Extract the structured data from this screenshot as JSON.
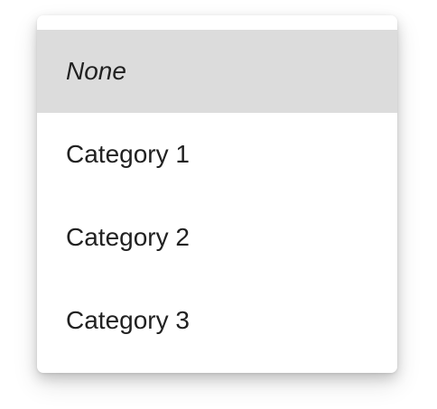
{
  "dropdown_menu": {
    "items": [
      {
        "label": "None",
        "selected": true,
        "italic": true
      },
      {
        "label": "Category 1",
        "selected": false,
        "italic": false
      },
      {
        "label": "Category 2",
        "selected": false,
        "italic": false
      },
      {
        "label": "Category 3",
        "selected": false,
        "italic": false
      }
    ],
    "colors": {
      "selected_background": "#dcdcdc",
      "text": "#212121",
      "surface": "#ffffff"
    }
  }
}
